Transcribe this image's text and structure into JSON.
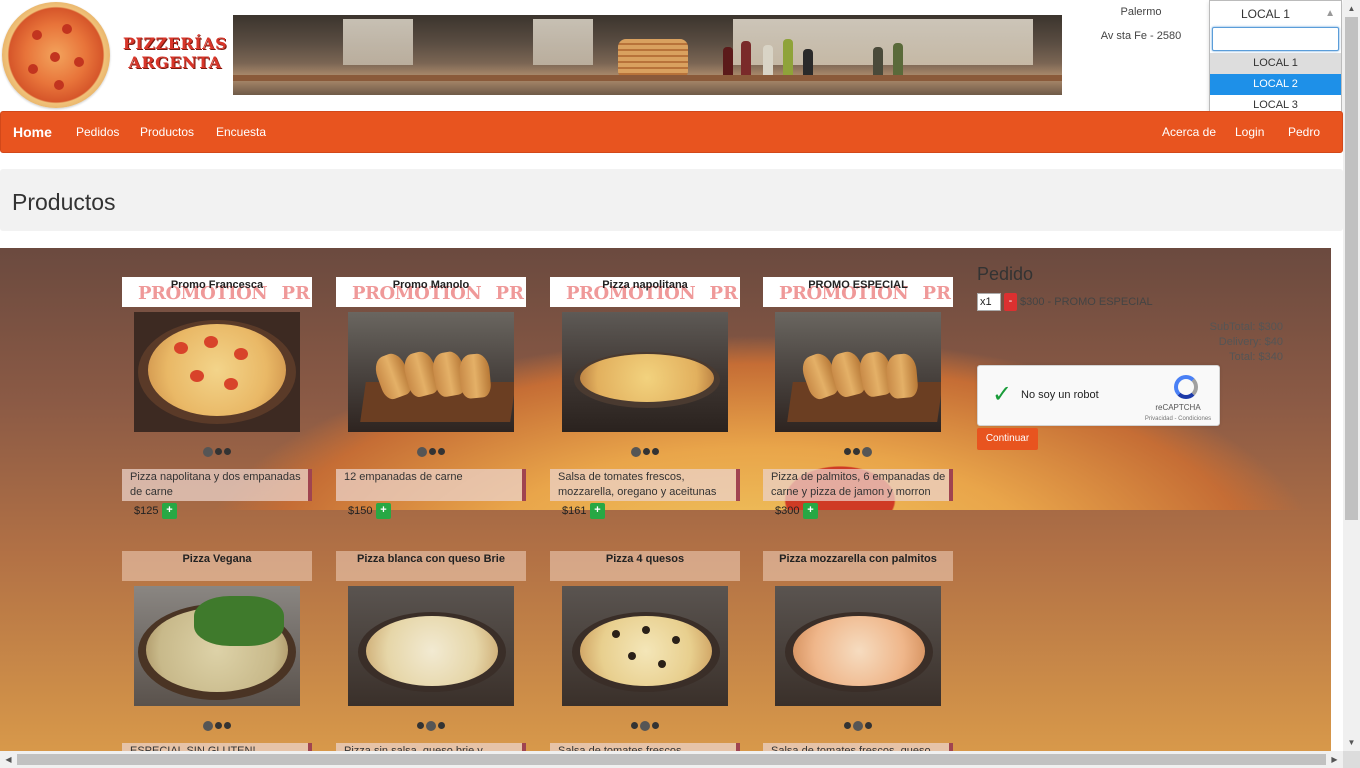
{
  "header": {
    "brand": "PIZZERÍAS ARGENTA",
    "location_name": "Palermo",
    "location_address": "Av sta Fe - 2580"
  },
  "local_select": {
    "selected": "LOCAL 1",
    "search_value": "",
    "options": [
      "LOCAL 1",
      "LOCAL 2",
      "LOCAL 3"
    ],
    "highlighted": "LOCAL 2"
  },
  "nav": {
    "home": "Home",
    "pedidos": "Pedidos",
    "productos": "Productos",
    "encuesta": "Encuesta",
    "acerca": "Acerca de",
    "login": "Login",
    "user": "Pedro"
  },
  "page_title": "Productos",
  "products": [
    {
      "name": "Promo Francesca",
      "promo": true,
      "desc": "Pizza napolitana y dos empanadas de carne",
      "price": "$125"
    },
    {
      "name": "Promo Manolo",
      "promo": true,
      "desc": "12 empanadas de carne",
      "price": "$150"
    },
    {
      "name": "Pizza napolitana",
      "promo": true,
      "desc": "Salsa de tomates frescos, mozzarella, oregano y aceitunas",
      "price": "$161"
    },
    {
      "name": "PROMO ESPECIAL",
      "promo": true,
      "desc": "Pizza de palmitos, 6 empanadas de carne y pizza de jamon y morron",
      "price": "$300"
    },
    {
      "name": "Pizza Vegana",
      "promo": false,
      "desc": "ESPECIAL SIN GLUTEN!",
      "price": ""
    },
    {
      "name": "Pizza blanca con queso Brie",
      "promo": false,
      "desc": "Pizza sin salsa, queso brie y",
      "price": ""
    },
    {
      "name": "Pizza 4 quesos",
      "promo": false,
      "desc": "Salsa de tomates frescos",
      "price": ""
    },
    {
      "name": "Pizza mozzarella con palmitos",
      "promo": false,
      "desc": "Salsa de tomates frescos, queso",
      "price": ""
    }
  ],
  "add_label": "+",
  "order": {
    "title": "Pedido",
    "qty": "x1",
    "remove_label": "-",
    "line": "$300 - PROMO ESPECIAL",
    "subtotal": "SubTotal: $300",
    "delivery": "Delivery: $40",
    "total": "Total: $340",
    "continue_label": "Continuar"
  },
  "captcha": {
    "label": "No soy un robot",
    "brand": "reCAPTCHA",
    "links": "Privacidad - Condiciones"
  },
  "colors": {
    "accent": "#e8541f",
    "add_button": "#27a844",
    "remove_button": "#dc3030",
    "select_highlight": "#1e90e8"
  }
}
